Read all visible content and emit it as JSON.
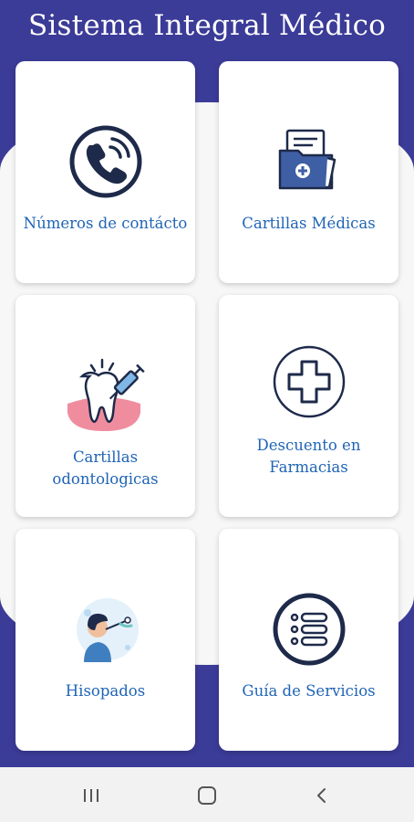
{
  "app": {
    "title": "Sistema Integral Médico"
  },
  "colors": {
    "header": "#3b3b98",
    "label": "#1f64b5",
    "icon_navy": "#1e2a4a"
  },
  "cards": [
    {
      "label": "Números de contácto",
      "icon": "phone-icon"
    },
    {
      "label": "Cartillas Médicas",
      "icon": "medical-folder-icon"
    },
    {
      "label": "Cartillas odontologicas",
      "icon": "tooth-syringe-icon"
    },
    {
      "label": "Descuento en Farmacias",
      "icon": "medical-cross-icon"
    },
    {
      "label": "Hisopados",
      "icon": "swab-test-icon"
    },
    {
      "label": "Guía de Servicios",
      "icon": "list-icon"
    }
  ],
  "navbar": {
    "buttons": [
      "recents-icon",
      "home-icon",
      "back-icon"
    ]
  }
}
